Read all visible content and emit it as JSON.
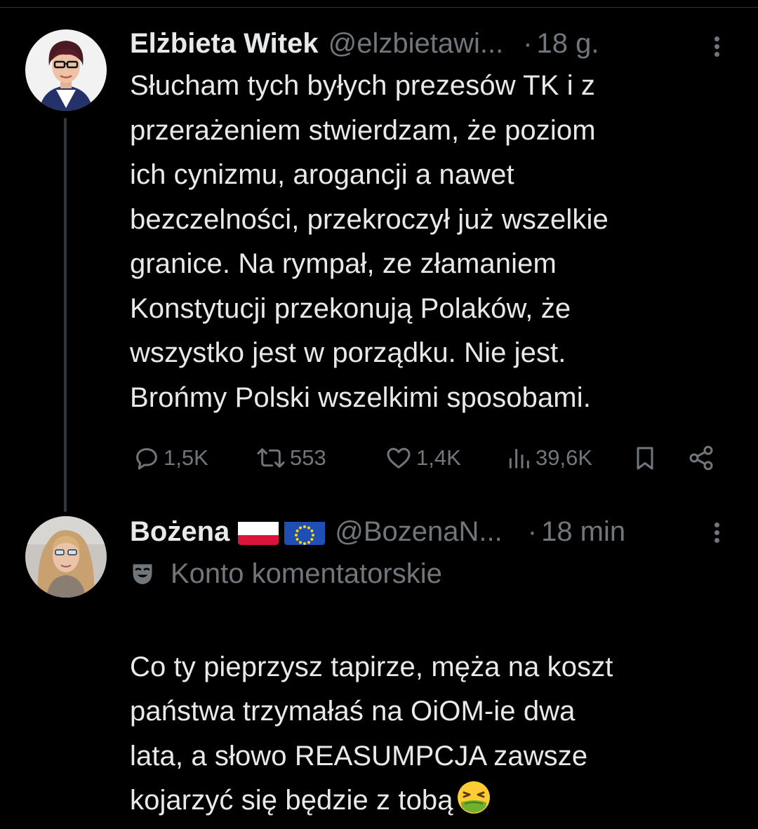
{
  "theme": {
    "background": "#000000",
    "text_primary": "#e7e9ea",
    "text_secondary": "#71767b",
    "thread_line": "#333639"
  },
  "tweets": [
    {
      "author_name": "Elżbieta Witek",
      "handle": "@elzbietawi...",
      "dot": "·",
      "time": "18 g.",
      "avatar_icon": "avatar-photo",
      "text": "Słucham tych byłych prezesów TK i z\nprzerażeniem stwierdzam, że poziom\nich cynizmu, arogancji a nawet\nbezczelności, przekroczył już wszelkie\ngranice. Na rympał, ze złamaniem\nKonstytucji  przekonują Polaków, że\nwszystko jest w porządku. Nie jest.\nBrońmy Polski wszelkimi sposobami.",
      "stats": {
        "replies": "1,5K",
        "retweets": "553",
        "likes": "1,4K",
        "views": "39,6K"
      },
      "icons": [
        "reply-icon",
        "retweet-icon",
        "like-icon",
        "views-icon",
        "bookmark-icon",
        "share-icon",
        "more-icon"
      ]
    },
    {
      "author_name": "Bożena",
      "flags": [
        "poland-flag-icon",
        "eu-flag-icon"
      ],
      "handle": "@BozenaN...",
      "dot": "·",
      "time": "18 min",
      "avatar_icon": "avatar-photo",
      "account_label": "Konto komentatorskie",
      "account_label_icon": "theater-masks-icon",
      "text": "Co ty pieprzysz tapirze, męża na koszt\npaństwa trzymałaś na OiOM-ie dwa\nlata, a słowo REASUMPCJA zawsze\nkojarzyć się będzie z tobą",
      "trailing_emoji": "nauseated-face-emoji"
    }
  ]
}
